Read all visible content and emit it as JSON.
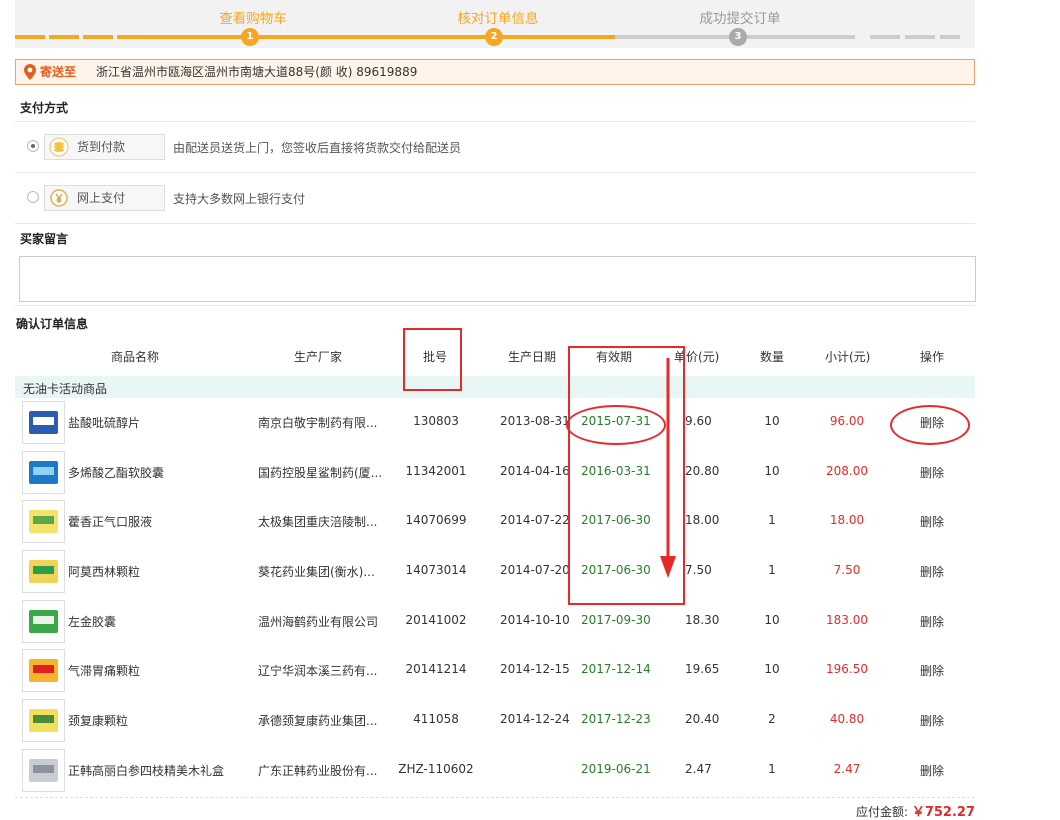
{
  "steps": [
    {
      "label": "查看购物车",
      "num": "1"
    },
    {
      "label": "核对订单信息",
      "num": "2"
    },
    {
      "label": "成功提交订单",
      "num": "3"
    }
  ],
  "address": {
    "label": "寄送至",
    "text": "浙江省温州市瓯海区温州市南塘大道88号(颜 收) 89619889"
  },
  "payment": {
    "title": "支付方式",
    "options": [
      {
        "label": "货到付款",
        "desc": "由配送员送货上门，您签收后直接将货款交付给配送员",
        "selected": true
      },
      {
        "label": "网上支付",
        "desc": "支持大多数网上银行支付",
        "selected": false
      }
    ]
  },
  "message": {
    "title": "买家留言",
    "value": ""
  },
  "order": {
    "title": "确认订单信息",
    "columns": [
      "商品名称",
      "生产厂家",
      "批号",
      "生产日期",
      "有效期",
      "单价(元)",
      "数量",
      "小计(元)",
      "操作"
    ],
    "group_label": "无油卡活动商品",
    "rows": [
      {
        "name": "盐酸吡硫醇片",
        "maker": "南京白敬宇制药有限...",
        "batch": "130803",
        "mfg": "2013-08-31",
        "exp": "2015-07-31",
        "price": "9.60",
        "qty": "10",
        "subtotal": "96.00",
        "action": "删除"
      },
      {
        "name": "多烯酸乙酯软胶囊",
        "maker": "国药控股星鲨制药(厦...",
        "batch": "11342001",
        "mfg": "2014-04-16",
        "exp": "2016-03-31",
        "price": "20.80",
        "qty": "10",
        "subtotal": "208.00",
        "action": "删除"
      },
      {
        "name": "藿香正气口服液",
        "maker": "太极集团重庆涪陵制...",
        "batch": "14070699",
        "mfg": "2014-07-22",
        "exp": "2017-06-30",
        "price": "18.00",
        "qty": "1",
        "subtotal": "18.00",
        "action": "删除"
      },
      {
        "name": "阿莫西林颗粒",
        "maker": "葵花药业集团(衡水)...",
        "batch": "14073014",
        "mfg": "2014-07-20",
        "exp": "2017-06-30",
        "price": "7.50",
        "qty": "1",
        "subtotal": "7.50",
        "action": "删除"
      },
      {
        "name": "左金胶囊",
        "maker": "温州海鹤药业有限公司",
        "batch": "20141002",
        "mfg": "2014-10-10",
        "exp": "2017-09-30",
        "price": "18.30",
        "qty": "10",
        "subtotal": "183.00",
        "action": "删除"
      },
      {
        "name": "气滞胃痛颗粒",
        "maker": "辽宁华润本溪三药有...",
        "batch": "20141214",
        "mfg": "2014-12-15",
        "exp": "2017-12-14",
        "price": "19.65",
        "qty": "10",
        "subtotal": "196.50",
        "action": "删除"
      },
      {
        "name": "颈复康颗粒",
        "maker": "承德颈复康药业集团...",
        "batch": "411058",
        "mfg": "2014-12-24",
        "exp": "2017-12-23",
        "price": "20.40",
        "qty": "2",
        "subtotal": "40.80",
        "action": "删除"
      },
      {
        "name": "正韩高丽白参四枝精美木礼盒",
        "maker": "广东正韩药业股份有...",
        "batch": "ZHZ-110602",
        "mfg": "",
        "exp": "2019-06-21",
        "price": "2.47",
        "qty": "1",
        "subtotal": "2.47",
        "action": "删除"
      }
    ],
    "total_label": "应付金额:",
    "total_value": "￥752.27"
  },
  "colors": {
    "accent": "#f5a623",
    "address_label": "#e35d1c",
    "subtotal": "#e32b2b",
    "expiry": "#2a7d2a",
    "annotation": "#e62a2a"
  }
}
